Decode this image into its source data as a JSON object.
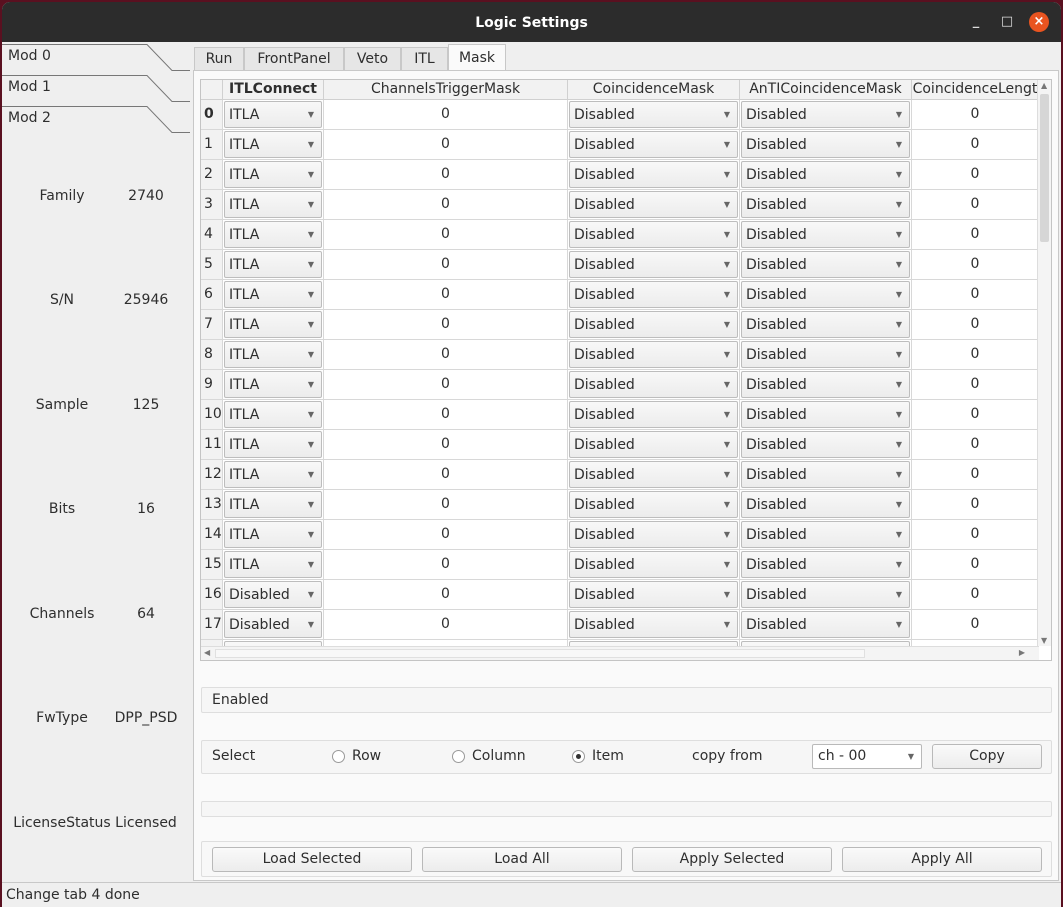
{
  "window": {
    "title": "Logic Settings",
    "minimize": "_",
    "maximize": "□",
    "close": "×"
  },
  "modules": [
    "Mod 0",
    "Mod 1",
    "Mod 2"
  ],
  "info": [
    {
      "label": "Family",
      "value": "2740"
    },
    {
      "label": "S/N",
      "value": "25946"
    },
    {
      "label": "Sample",
      "value": "125"
    },
    {
      "label": "Bits",
      "value": "16"
    },
    {
      "label": "Channels",
      "value": "64"
    },
    {
      "label": "FwType",
      "value": "DPP_PSD"
    },
    {
      "label": "LicenseStatus",
      "value": "Licensed"
    }
  ],
  "tabs": [
    {
      "label": "Run"
    },
    {
      "label": "FrontPanel"
    },
    {
      "label": "Veto"
    },
    {
      "label": "ITL"
    },
    {
      "label": "Mask",
      "active": true
    }
  ],
  "table": {
    "columns": [
      "ITLConnect",
      "ChannelsTriggerMask",
      "CoincidenceMask",
      "AnTICoincidenceMask",
      "CoincidenceLengt"
    ],
    "rows": [
      {
        "ch": "0",
        "itl": "ITLA",
        "trig": "0",
        "coin": "Disabled",
        "anti": "Disabled",
        "len": "0"
      },
      {
        "ch": "1",
        "itl": "ITLA",
        "trig": "0",
        "coin": "Disabled",
        "anti": "Disabled",
        "len": "0"
      },
      {
        "ch": "2",
        "itl": "ITLA",
        "trig": "0",
        "coin": "Disabled",
        "anti": "Disabled",
        "len": "0"
      },
      {
        "ch": "3",
        "itl": "ITLA",
        "trig": "0",
        "coin": "Disabled",
        "anti": "Disabled",
        "len": "0"
      },
      {
        "ch": "4",
        "itl": "ITLA",
        "trig": "0",
        "coin": "Disabled",
        "anti": "Disabled",
        "len": "0"
      },
      {
        "ch": "5",
        "itl": "ITLA",
        "trig": "0",
        "coin": "Disabled",
        "anti": "Disabled",
        "len": "0"
      },
      {
        "ch": "6",
        "itl": "ITLA",
        "trig": "0",
        "coin": "Disabled",
        "anti": "Disabled",
        "len": "0"
      },
      {
        "ch": "7",
        "itl": "ITLA",
        "trig": "0",
        "coin": "Disabled",
        "anti": "Disabled",
        "len": "0"
      },
      {
        "ch": "8",
        "itl": "ITLA",
        "trig": "0",
        "coin": "Disabled",
        "anti": "Disabled",
        "len": "0"
      },
      {
        "ch": "9",
        "itl": "ITLA",
        "trig": "0",
        "coin": "Disabled",
        "anti": "Disabled",
        "len": "0"
      },
      {
        "ch": "10",
        "itl": "ITLA",
        "trig": "0",
        "coin": "Disabled",
        "anti": "Disabled",
        "len": "0"
      },
      {
        "ch": "11",
        "itl": "ITLA",
        "trig": "0",
        "coin": "Disabled",
        "anti": "Disabled",
        "len": "0"
      },
      {
        "ch": "12",
        "itl": "ITLA",
        "trig": "0",
        "coin": "Disabled",
        "anti": "Disabled",
        "len": "0"
      },
      {
        "ch": "13",
        "itl": "ITLA",
        "trig": "0",
        "coin": "Disabled",
        "anti": "Disabled",
        "len": "0"
      },
      {
        "ch": "14",
        "itl": "ITLA",
        "trig": "0",
        "coin": "Disabled",
        "anti": "Disabled",
        "len": "0"
      },
      {
        "ch": "15",
        "itl": "ITLA",
        "trig": "0",
        "coin": "Disabled",
        "anti": "Disabled",
        "len": "0"
      },
      {
        "ch": "16",
        "itl": "Disabled",
        "trig": "0",
        "coin": "Disabled",
        "anti": "Disabled",
        "len": "0"
      },
      {
        "ch": "17",
        "itl": "Disabled",
        "trig": "0",
        "coin": "Disabled",
        "anti": "Disabled",
        "len": "0"
      }
    ]
  },
  "enabled_text": "Enabled",
  "select": {
    "label": "Select",
    "options": [
      {
        "label": "Row",
        "checked": false
      },
      {
        "label": "Column",
        "checked": false
      },
      {
        "label": "Item",
        "checked": true
      }
    ],
    "copy_from_label": "copy from",
    "copy_from_value": "ch - 00",
    "copy_button": "Copy"
  },
  "actions": [
    "Load Selected",
    "Load All",
    "Apply Selected",
    "Apply All"
  ],
  "status": "Change tab 4 done"
}
